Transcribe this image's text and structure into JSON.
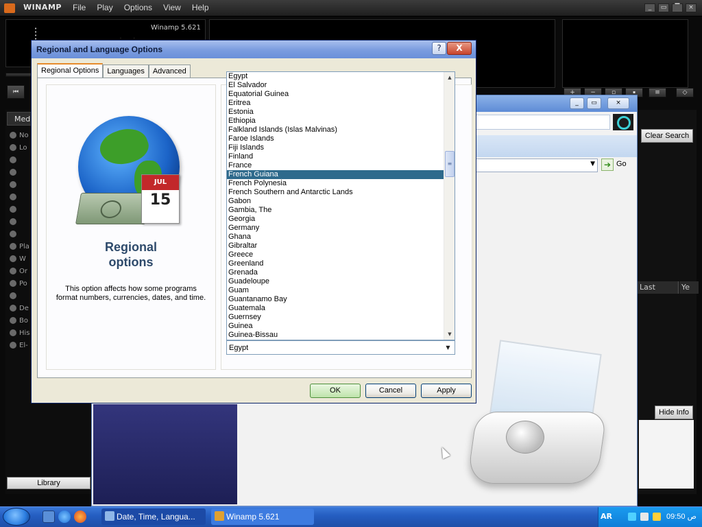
{
  "winamp": {
    "title": "WINAMP",
    "menu": [
      "File",
      "Play",
      "Options",
      "View",
      "Help"
    ],
    "version": "Winamp 5.621",
    "media_tab": "Med",
    "library_button": "Library",
    "clear_search": "Clear Search",
    "columns": [
      "Last",
      "Ye"
    ],
    "hide_info": "Hide Info",
    "go": "Go",
    "tree_items": [
      "No",
      "Lo",
      "Pla",
      "W",
      "Or",
      "Po",
      "De",
      "Bo",
      "His",
      "El-"
    ]
  },
  "dialog": {
    "title": "Regional and Language Options",
    "tabs": [
      "Regional Options",
      "Languages",
      "Advanced"
    ],
    "heading_line1": "Regional",
    "heading_line2": "options",
    "description": "This option affects how some programs format numbers, currencies, dates, and time.",
    "calendar_month": "JUL",
    "calendar_day": "15",
    "countries": [
      "Egypt",
      "El Salvador",
      "Equatorial Guinea",
      "Eritrea",
      "Estonia",
      "Ethiopia",
      "Falkland Islands (Islas Malvinas)",
      "Faroe Islands",
      "Fiji Islands",
      "Finland",
      "France",
      "French Guiana",
      "French Polynesia",
      "French Southern and Antarctic Lands",
      "Gabon",
      "Gambia, The",
      "Georgia",
      "Germany",
      "Ghana",
      "Gibraltar",
      "Greece",
      "Greenland",
      "Grenada",
      "Guadeloupe",
      "Guam",
      "Guantanamo Bay",
      "Guatemala",
      "Guernsey",
      "Guinea",
      "Guinea-Bissau"
    ],
    "selected_country": "French Guiana",
    "location_value": "Egypt",
    "ok_label": "OK",
    "cancel_label": "Cancel",
    "apply_label": "Apply",
    "close_label": "X",
    "help_label": "?"
  },
  "taskbar": {
    "tasks": [
      "Date, Time, Langua...",
      "Winamp 5.621"
    ],
    "language": "AR",
    "clock": "09:50 ص"
  },
  "colors": {
    "selection": "#2e6a8c",
    "title_bar": "#7d9ee0",
    "taskbar": "#245dc0"
  }
}
